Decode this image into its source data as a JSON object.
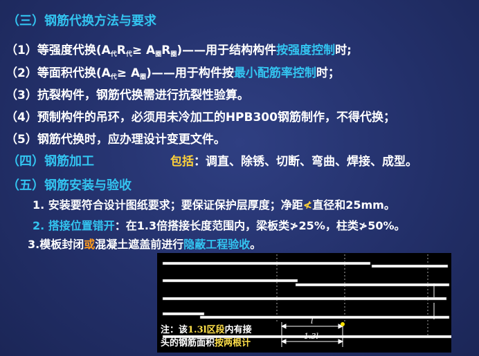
{
  "section3": {
    "title": "（三）钢筋代换方法与要求",
    "items": [
      {
        "prefix": "（1）等强度代换(A",
        "s1": "代",
        "m1": "R",
        "s2": "代",
        "m2": "≥ A",
        "s3": "圈",
        "m3": "R",
        "s4": "圈",
        "suffix": ")——用于结构构件",
        "hl": "按强度控制",
        "end": "时;"
      },
      {
        "prefix": "（2）等面积代换(A",
        "s1": "代",
        "m1": "≥ A",
        "s2": "圈",
        "suffix": ")——用于构件按",
        "hl": "最小配筋率控制",
        "end": "时；"
      },
      {
        "text": "（3）抗裂构件，钢筋代换需进行抗裂性验算。"
      },
      {
        "text": "（4）预制构件的吊环，必须用未冷加工的HPB300钢筋制作，不得代换；"
      },
      {
        "text": "（5）钢筋代换时，应办理设计变更文件。"
      }
    ]
  },
  "section4": {
    "title": "（四）钢筋加工",
    "include_label": "包括",
    "include_text": "：调直、除锈、切断、弯曲、焊接、成型。"
  },
  "section5": {
    "title": "（五）钢筋安装与验收",
    "item1": "1. 安装要符合设计图纸要求；要保证保护层厚度；净距",
    "item1_symbol": "≮",
    "item1_end": "直径和25mm。",
    "item2_num": "2. ",
    "item2_hl": "搭接位置错开",
    "item2_text": "：在1.3倍搭接长度范围内，梁板类≯25%，柱类≯50%。",
    "item3_a": "3.模板封闭",
    "item3_or": "或",
    "item3_b": "混凝土遮盖前进行",
    "item3_hl": "隐蔽工程验收",
    "item3_end": "。"
  },
  "figure": {
    "label_l": "l",
    "label_13l": "1.3l",
    "note_a": "注：该",
    "note_y1": "1.3l",
    "note_b": "区段",
    "note_c": "内有接",
    "note_d": "头的钢筋面积",
    "note_y2": "按两根计"
  },
  "colors": {
    "background": "#23306a",
    "heading": "#33c4f0",
    "highlight": "#ffd23a",
    "accent": "#ff9a1e"
  }
}
